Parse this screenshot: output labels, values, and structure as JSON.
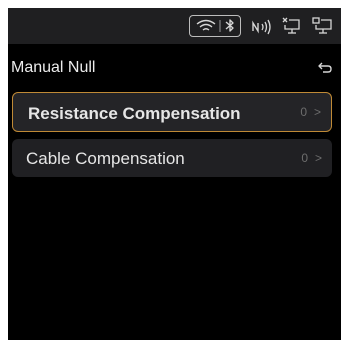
{
  "status_bar": {
    "icons": [
      "wifi-icon",
      "bluetooth-icon",
      "nfc-icon",
      "monitor-icon",
      "monitor-icon"
    ]
  },
  "header": {
    "title": "Manual Null",
    "back_icon": "back-icon"
  },
  "menu": {
    "items": [
      {
        "label": "Resistance Compensation",
        "value": "0",
        "selected": true
      },
      {
        "label": "Cable Compensation",
        "value": "0",
        "selected": false
      }
    ]
  },
  "colors": {
    "background": "#000000",
    "status_bar": "#1f1f21",
    "item_background": "#202023",
    "selected_border": "#c08a36",
    "text": "#e6e6e6",
    "muted_text": "#6d6d6d"
  }
}
